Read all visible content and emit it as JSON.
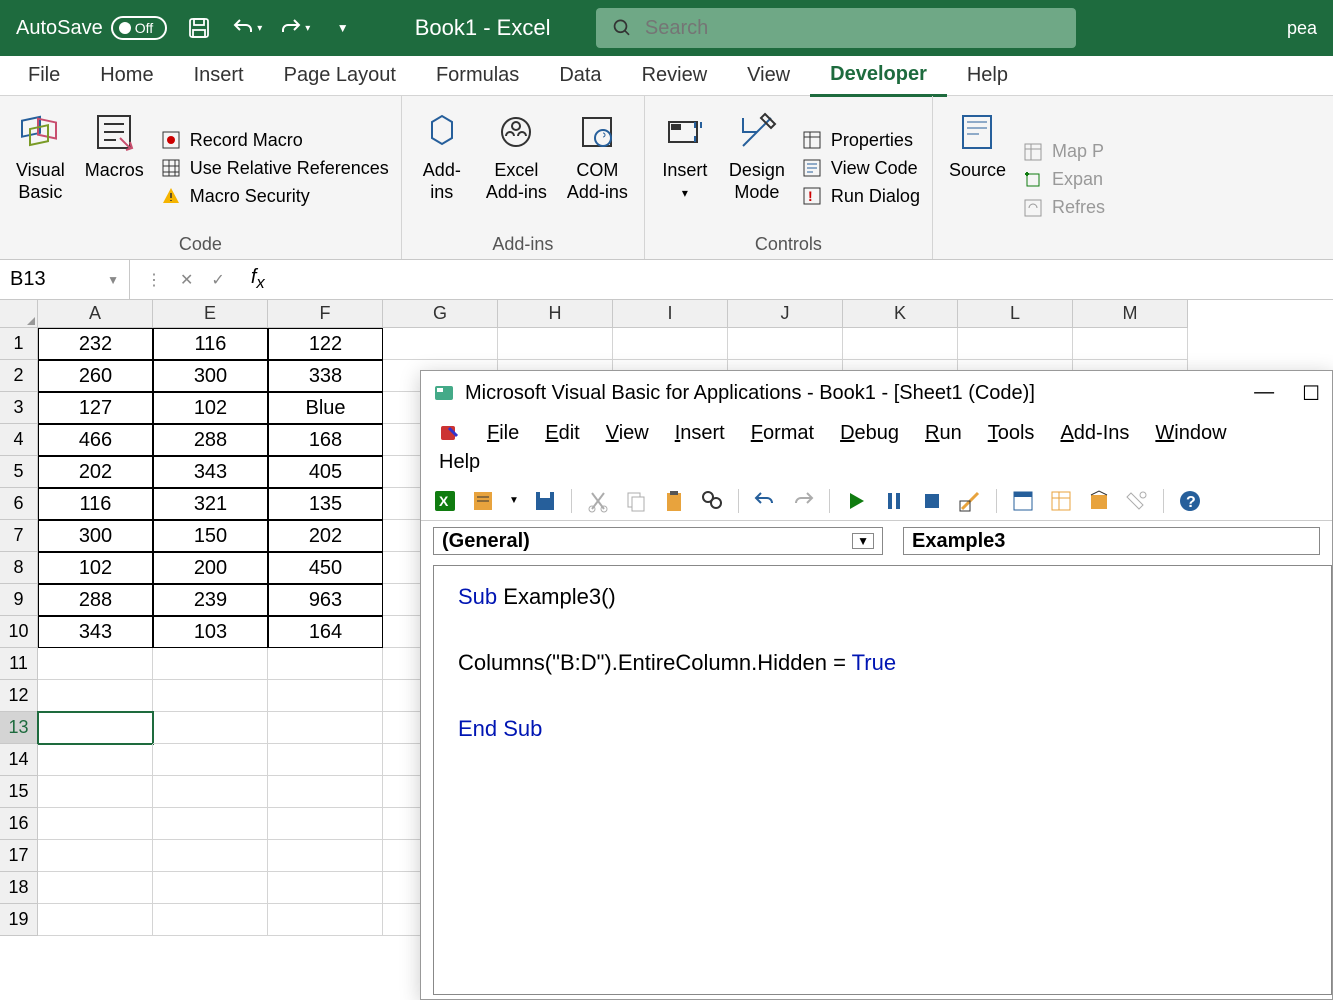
{
  "title_bar": {
    "autosave_label": "AutoSave",
    "autosave_state": "Off",
    "doc_title": "Book1 - Excel",
    "search_placeholder": "Search",
    "user_text": "pea"
  },
  "tabs": [
    "File",
    "Home",
    "Insert",
    "Page Layout",
    "Formulas",
    "Data",
    "Review",
    "View",
    "Developer",
    "Help"
  ],
  "active_tab": "Developer",
  "ribbon": {
    "code": {
      "visual_basic": "Visual\nBasic",
      "macros": "Macros",
      "record_macro": "Record Macro",
      "relative_refs": "Use Relative References",
      "macro_security": "Macro Security",
      "group_label": "Code"
    },
    "addins": {
      "addins": "Add-\nins",
      "excel": "Excel\nAdd-ins",
      "com": "COM\nAdd-ins",
      "group_label": "Add-ins"
    },
    "controls": {
      "insert": "Insert",
      "design": "Design\nMode",
      "properties": "Properties",
      "view_code": "View Code",
      "run_dialog": "Run Dialog",
      "group_label": "Controls"
    },
    "xml": {
      "source": "Source",
      "map_props": "Map P",
      "expansion": "Expan",
      "refresh": "Refres"
    }
  },
  "namebox": "B13",
  "grid": {
    "columns": [
      "A",
      "E",
      "F",
      "G",
      "H",
      "I",
      "J",
      "K",
      "L",
      "M"
    ],
    "rows": 19,
    "data": [
      [
        "232",
        "116",
        "122"
      ],
      [
        "260",
        "300",
        "338"
      ],
      [
        "127",
        "102",
        "Blue"
      ],
      [
        "466",
        "288",
        "168"
      ],
      [
        "202",
        "343",
        "405"
      ],
      [
        "116",
        "321",
        "135"
      ],
      [
        "300",
        "150",
        "202"
      ],
      [
        "102",
        "200",
        "450"
      ],
      [
        "288",
        "239",
        "963"
      ],
      [
        "343",
        "103",
        "164"
      ]
    ],
    "selected_row": 13
  },
  "vba": {
    "title": "Microsoft Visual Basic for Applications - Book1 - [Sheet1 (Code)]",
    "menus": [
      "File",
      "Edit",
      "View",
      "Insert",
      "Format",
      "Debug",
      "Run",
      "Tools",
      "Add-Ins",
      "Window"
    ],
    "help": "Help",
    "combo1": "(General)",
    "combo2": "Example3",
    "code": {
      "line1_kw": "Sub",
      "line1_rest": " Example3()",
      "line2": "    Columns(\"B:D\").EntireColumn.Hidden = ",
      "line2_val": "True",
      "line3_kw": "End Sub"
    }
  }
}
